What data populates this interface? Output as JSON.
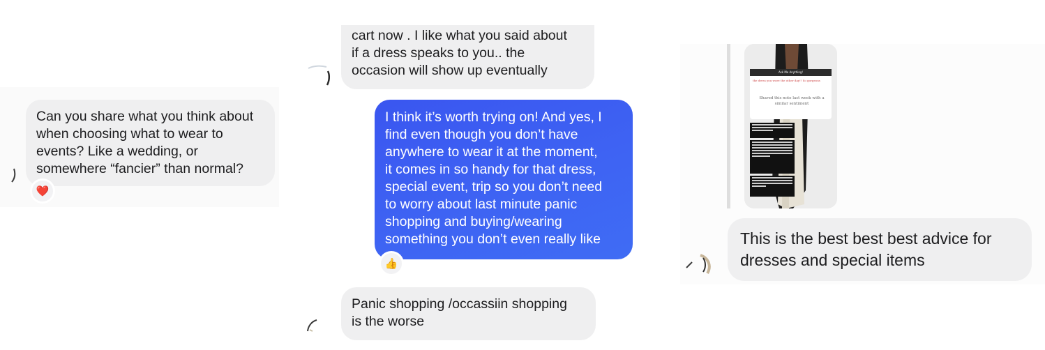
{
  "left": {
    "message_lines": [
      "Can you share what you think about",
      "when choosing what to wear to",
      "events? Like a wedding, or",
      "somewhere “fancier” than normal?"
    ],
    "reaction": "❤️"
  },
  "middle": {
    "received_top_lines": [
      "cart now . I like what you said about",
      "if a dress speaks to you.. the",
      "occasion will show up eventually"
    ],
    "sent_lines": [
      "I think it’s worth trying on! And yes, I",
      "find even though you don’t have",
      "anywhere to wear it at the moment,",
      "it comes in so handy for that dress,",
      "special event, trip so you don’t need",
      "to worry about last minute panic",
      "shopping and buying/wearing",
      "something you don’t even really like"
    ],
    "sent_reaction": "👍",
    "received_bottom_lines": [
      "Panic shopping /occassiin shopping",
      "is the worse"
    ]
  },
  "right": {
    "story_header": "Ask Me Anything!",
    "story_question": "the dress you wore the other day!! So gorgeous",
    "story_caption": "Shared this note last week with a similar sentiment",
    "message_lines": [
      "This is the best best best advice for",
      "dresses and special items"
    ]
  },
  "colors": {
    "received_bubble": "#efeff0",
    "sent_bubble": "#3e5ff2",
    "received_text": "#1c1c1e",
    "sent_text": "#ffffff"
  }
}
